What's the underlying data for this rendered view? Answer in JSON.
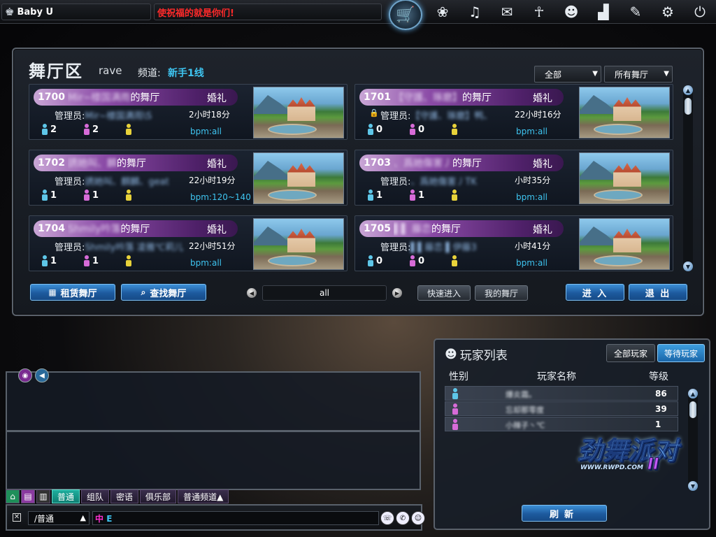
{
  "topbar": {
    "username": "Baby U",
    "motd": "使祝福的就是你们!",
    "icons": [
      "shop-cart-icon",
      "couple-icon",
      "music-box-icon",
      "chat-bubble-icon",
      "dancer-icon",
      "group-icon",
      "podium-icon",
      "notebook-icon",
      "gear-icon",
      "power-icon"
    ]
  },
  "hall": {
    "title": "舞厅区",
    "mode": "rave",
    "channel_label": "频道:",
    "channel_value": "新手1线",
    "filter_all": "全部",
    "filter_halls": "所有舞厅",
    "rooms": [
      {
        "num": "1700",
        "name": "Mir~楼国满雨",
        "suffix": "的舞厅",
        "tag": "婚礼",
        "mgr_label": "管理员:",
        "mgr": "Mir~楼国满雨\\S",
        "time": "2小时18分",
        "male": "2",
        "female": "2",
        "bpm": "bpm:all",
        "locked": false
      },
      {
        "num": "1701",
        "name": "【守護、琢磨】",
        "suffix": "的舞厅",
        "tag": "婚礼",
        "mgr_label": "管理员:",
        "mgr": "【守護、琢磨】鸭、",
        "time": "22小时16分",
        "male": "0",
        "female": "0",
        "bpm": "bpm:all",
        "locked": true
      },
      {
        "num": "1702",
        "name": "誘她叫、麟",
        "suffix": "的舞厅",
        "tag": "婚礼",
        "mgr_label": "管理员:",
        "mgr": "誘她叫、麒麟、geat",
        "time": "22小时19分",
        "male": "1",
        "female": "1",
        "bpm": "bpm:120~140",
        "locked": false
      },
      {
        "num": "1703",
        "name": "、爲她傷害丿",
        "suffix": "的舞厅",
        "tag": "婚礼",
        "mgr_label": "管理员:",
        "mgr": "、爲她傷害丿TK",
        "time": "小时35分",
        "male": "1",
        "female": "1",
        "bpm": "bpm:all",
        "locked": false
      },
      {
        "num": "1704",
        "name": "Shmily吟落",
        "suffix": "的舞厅",
        "tag": "婚礼",
        "mgr_label": "管理员:",
        "mgr": "Shmily吟落 凌雅℃莉儿",
        "time": "22小时51分",
        "male": "1",
        "female": "1",
        "bpm": "bpm:all",
        "locked": false
      },
      {
        "num": "1705",
        "name": "▌▌ 藤恋",
        "suffix": "的舞厅",
        "tag": "婚礼",
        "mgr_label": "管理员:",
        "mgr": "▌▌藤恋 ▌伊藤3",
        "time": "小时41分",
        "male": "0",
        "female": "0",
        "bpm": "bpm:all",
        "locked": false
      }
    ],
    "rent_label": "租赁舞厅",
    "find_label": "查找舞厅",
    "page_value": "all",
    "quick_enter": "快速进入",
    "my_hall": "我的舞厅",
    "enter": "进 入",
    "exit": "退 出"
  },
  "chat": {
    "tabs": [
      "普通",
      "组队",
      "密语",
      "俱乐部",
      "普通频道▲"
    ],
    "mode": "/普通",
    "ime_zh": "中",
    "ime_en": "E"
  },
  "players": {
    "title": "玩家列表",
    "tab_all": "全部玩家",
    "tab_waiting": "等待玩家",
    "col_gender": "性别",
    "col_name": "玩家名称",
    "col_level": "等级",
    "rows": [
      {
        "gender": "male",
        "name": "爆炎霜。",
        "level": "86"
      },
      {
        "gender": "female",
        "name": "忘却那零度",
        "level": "39"
      },
      {
        "gender": "female",
        "name": "小辣子丶℃",
        "level": "1"
      }
    ],
    "logo_text": "劲舞派对",
    "logo_sub": "WWW.RWPD.COM",
    "logo_two": "II",
    "refresh": "刷新"
  },
  "colors": {
    "accent": "#3ec4f0",
    "male": "#5ec6e8",
    "female": "#d76bd8",
    "alert": "#ff2a2a"
  }
}
